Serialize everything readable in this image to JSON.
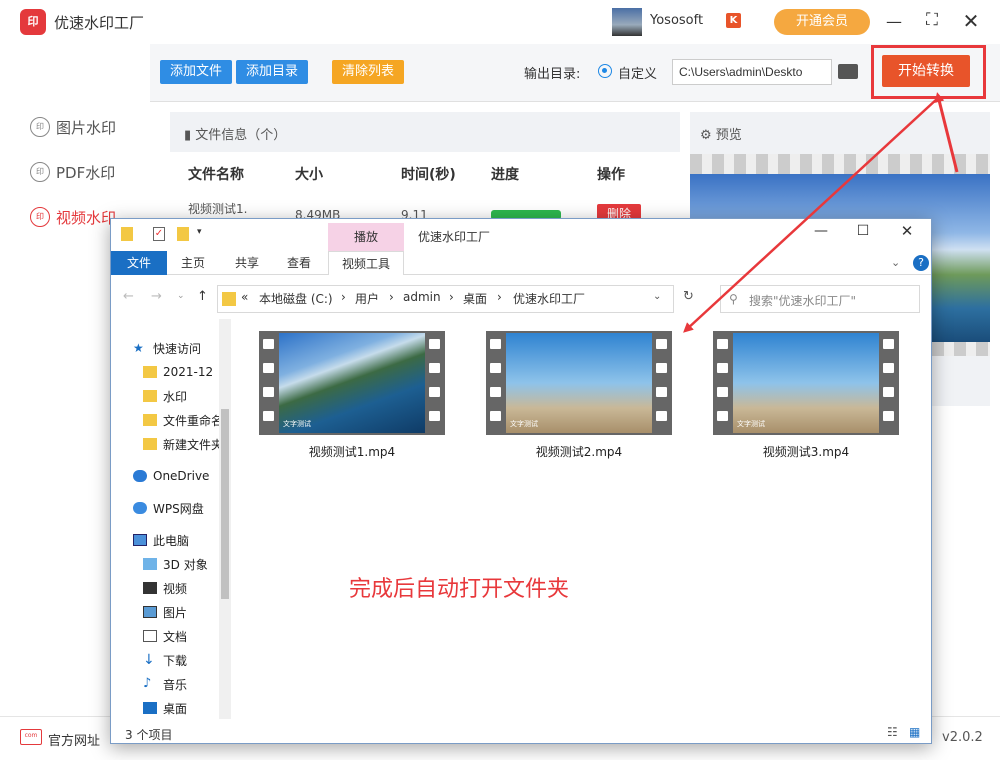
{
  "app": {
    "title": "优速水印工厂",
    "logo_text": "印",
    "user": "Yososoft",
    "user_badge": "K",
    "vip": "开通会员",
    "version": "v2.0.2"
  },
  "window_controls": {
    "minimize": "—",
    "maximize": "⛶",
    "close": "✕"
  },
  "nav": {
    "items": [
      {
        "label": "图片水印"
      },
      {
        "label": "PDF水印"
      },
      {
        "label": "视频水印"
      }
    ],
    "icon_text": "印"
  },
  "toolbar": {
    "add_file": "添加文件",
    "add_dir": "添加目录",
    "clear": "清除列表",
    "output_label": "输出目录:",
    "radio_label": "自定义",
    "path_value": "C:\\Users\\admin\\Deskto",
    "start": "开始转换"
  },
  "fileinfo": {
    "title": "文件信息（个）",
    "columns": [
      "文件名称",
      "大小",
      "时间(秒)",
      "进度",
      "操作"
    ],
    "row": {
      "name": "视频测试1.",
      "size": "8.49MB",
      "time": "9.11",
      "progress": 1,
      "action": "删除"
    }
  },
  "preview": {
    "title": "预览"
  },
  "bottom": {
    "site": "官方网址",
    "site_icon": "com"
  },
  "explorer": {
    "title": "优速水印工厂",
    "play_tab": "播放",
    "tabs": [
      "文件",
      "主页",
      "共享",
      "查看",
      "视频工具"
    ],
    "address": [
      "«",
      "本地磁盘 (C:)",
      "›",
      "用户",
      "›",
      "admin",
      "›",
      "桌面",
      "›",
      "优速水印工厂"
    ],
    "search_placeholder": "搜索\"优速水印工厂\"",
    "nav_items": [
      {
        "label": "快速访问",
        "icon": "star-icon"
      },
      {
        "label": "2021-12",
        "icon": "folder-icon"
      },
      {
        "label": "水印",
        "icon": "folder-icon"
      },
      {
        "label": "文件重命名",
        "icon": "folder-icon"
      },
      {
        "label": "新建文件夹",
        "icon": "folder-icon"
      },
      {
        "label": "OneDrive",
        "icon": "cloud-icon"
      },
      {
        "label": "WPS网盘",
        "icon": "cloud-icon"
      },
      {
        "label": "此电脑",
        "icon": "pc-icon"
      },
      {
        "label": "3D 对象",
        "icon": "cube-icon"
      },
      {
        "label": "视频",
        "icon": "video-icon"
      },
      {
        "label": "图片",
        "icon": "picture-icon"
      },
      {
        "label": "文档",
        "icon": "document-icon"
      },
      {
        "label": "下载",
        "icon": "download-icon"
      },
      {
        "label": "音乐",
        "icon": "music-icon"
      },
      {
        "label": "桌面",
        "icon": "desktop-icon"
      }
    ],
    "files": [
      {
        "name": "视频测试1.mp4",
        "caption": "文字测试"
      },
      {
        "name": "视频测试2.mp4",
        "caption": "文字测试"
      },
      {
        "name": "视频测试3.mp4",
        "caption": "文字测试"
      }
    ],
    "status": "3 个项目",
    "window_controls": {
      "minimize": "—",
      "maximize": "☐",
      "close": "✕"
    }
  },
  "annotation": "完成后自动打开文件夹",
  "colors": {
    "accent": "#e4393c",
    "start": "#e8542a",
    "blue": "#2f8de4",
    "orange": "#f5a623"
  }
}
